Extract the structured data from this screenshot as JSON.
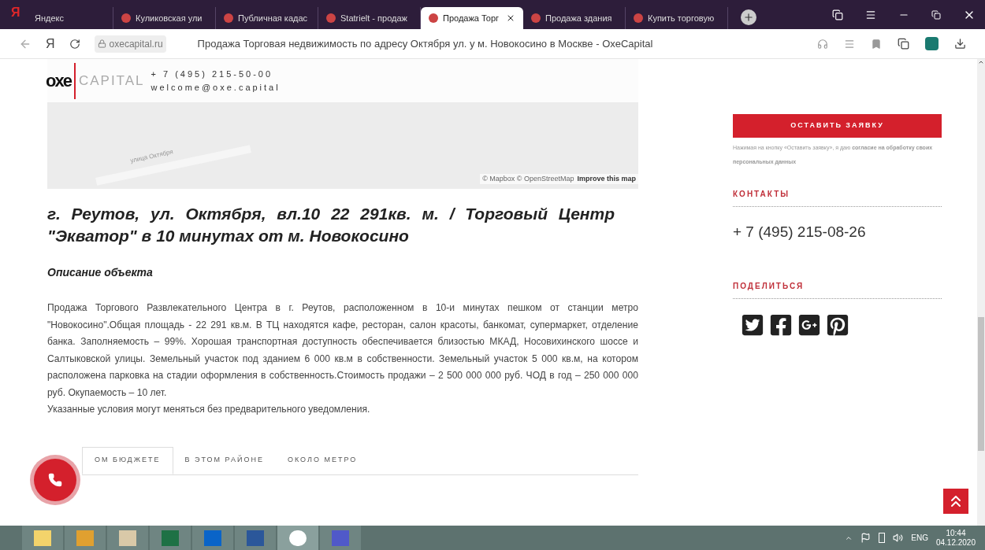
{
  "browser": {
    "tab_strip_logo": "Я",
    "address_logo": "Я",
    "tabs": [
      {
        "label": "Яндекс",
        "selected": false
      },
      {
        "label": "Куликовская ули",
        "selected": false
      },
      {
        "label": "Публичная кадас",
        "selected": false
      },
      {
        "label": "Statrielt - продаж",
        "selected": false
      },
      {
        "label": "Продажа Торг",
        "selected": true
      },
      {
        "label": "Продажа здания",
        "selected": false
      },
      {
        "label": "Купить торговую",
        "selected": false
      }
    ],
    "domain": "oxecapital.ru",
    "page_title": "Продажа Торговая недвижимость по адресу Октября ул. у м. Новокосино в Москве - OxeCapital"
  },
  "header": {
    "logo_mark": "oxe",
    "logo_word": "CAPITAL",
    "phone": "+ 7 (495) 215-50-00",
    "email": "welcome@oxe.capital"
  },
  "map": {
    "street_label": "улица Октября",
    "attribution": "© Mapbox © OpenStreetMap",
    "improve_link": "Improve this map"
  },
  "listing": {
    "title": "г. Реутов, ул. Октября, вл.10 22 291кв. м. / Торговый Центр \"Экватор\" в 10 минутах от м. Новокосино",
    "description_heading": "Описание объекта",
    "description": "Продажа Торгового Развлекательного Центра в г. Реутов, расположенном в 10-и минутах пешком от станции метро \"Новокосино\".Общая площадь - 22 291 кв.м. В ТЦ находятся кафе, ресторан, салон красоты, банкомат, супермаркет, отделение банка. Заполняемость – 99%. Хорошая транспортная доступность обеспечивается близостью МКАД, Носовихинского шоссе и Салтыковской улицы. Земельный участок под зданием 6 000 кв.м в собственности. Земельный участок 5 000 кв.м, на котором расположена парковка на стадии оформления в собственность.Стоимость продажи – 2 500 000 000 руб. ЧОД в год  – 250 000 000 руб. Окупаемость – 10 лет.",
    "note": "Указанные условия могут меняться без предварительного уведомления."
  },
  "related_tabs": [
    {
      "label": "ОМ БЮДЖЕТЕ",
      "selected": true
    },
    {
      "label": "В ЭТОМ РАЙОНЕ",
      "selected": false
    },
    {
      "label": "ОКОЛО МЕТРО",
      "selected": false
    }
  ],
  "sidebar": {
    "submit_button": "ОСТАВИТЬ ЗАЯВКУ",
    "consent": "Нажимая на кнопку «Оставить заявку», я даю **согласие на обработку своих персональных данных**",
    "contacts_heading": "КОНТАКТЫ",
    "contact_phone": "+ 7 (495) 215-08-26",
    "share_heading": "ПОДЕЛИТЬСЯ"
  },
  "taskbar": {
    "language": "ENG",
    "time": "10:44",
    "date": "04.12.2020"
  }
}
